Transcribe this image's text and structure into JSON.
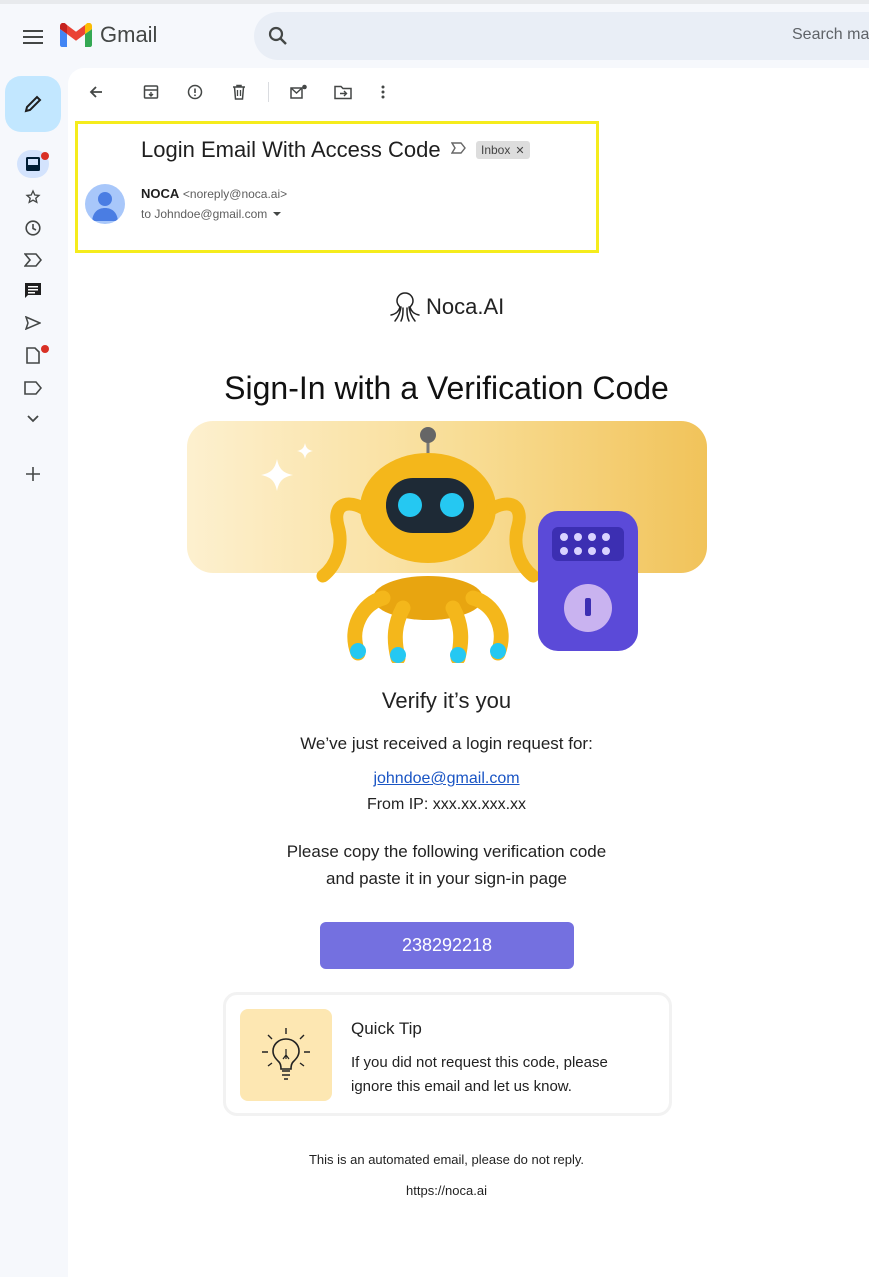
{
  "app": {
    "name": "Gmail",
    "search_placeholder": "Search mail"
  },
  "rail": {
    "items": [
      {
        "name": "inbox",
        "active": true,
        "badge": true
      },
      {
        "name": "starred"
      },
      {
        "name": "snoozed"
      },
      {
        "name": "important"
      },
      {
        "name": "chat"
      },
      {
        "name": "sent"
      },
      {
        "name": "drafts",
        "badge": true
      },
      {
        "name": "labels"
      },
      {
        "name": "more"
      },
      {
        "name": "add"
      }
    ]
  },
  "toolbar": {
    "icons": [
      "back-icon",
      "archive-icon",
      "report-spam-icon",
      "delete-icon",
      "mark-unread-icon",
      "move-to-icon",
      "more-vert-icon"
    ]
  },
  "email": {
    "subject": "Login Email With Access Code",
    "label_chip": "Inbox",
    "sender_name": "NOCA",
    "sender_email": "<noreply@noca.ai>",
    "to_line": "to Johndoe@gmail.com"
  },
  "body": {
    "brand": "Noca.AI",
    "hero_title": "Sign-In with a Verification Code",
    "verify_title": "Verify it’s you",
    "received_text": "We’ve just received a login request for:",
    "email_link": "johndoe@gmail.com",
    "ip_line": "From IP: xxx.xx.xxx.xx",
    "copy_line1": "Please copy the following verification code",
    "copy_line2": "and paste it in your sign-in page",
    "code": "238292218",
    "tip_title": "Quick Tip",
    "tip_text": "If you did not request this code, please ignore this email and let us know.",
    "footer_note": "This is an automated email, please do not reply.",
    "footer_url": "https://noca.ai"
  },
  "colors": {
    "accent": "#7470e0",
    "highlight_box": "#f5ec1c",
    "compose_bg": "#c2e7ff",
    "link": "#1a55c4",
    "badge": "#d93025"
  }
}
